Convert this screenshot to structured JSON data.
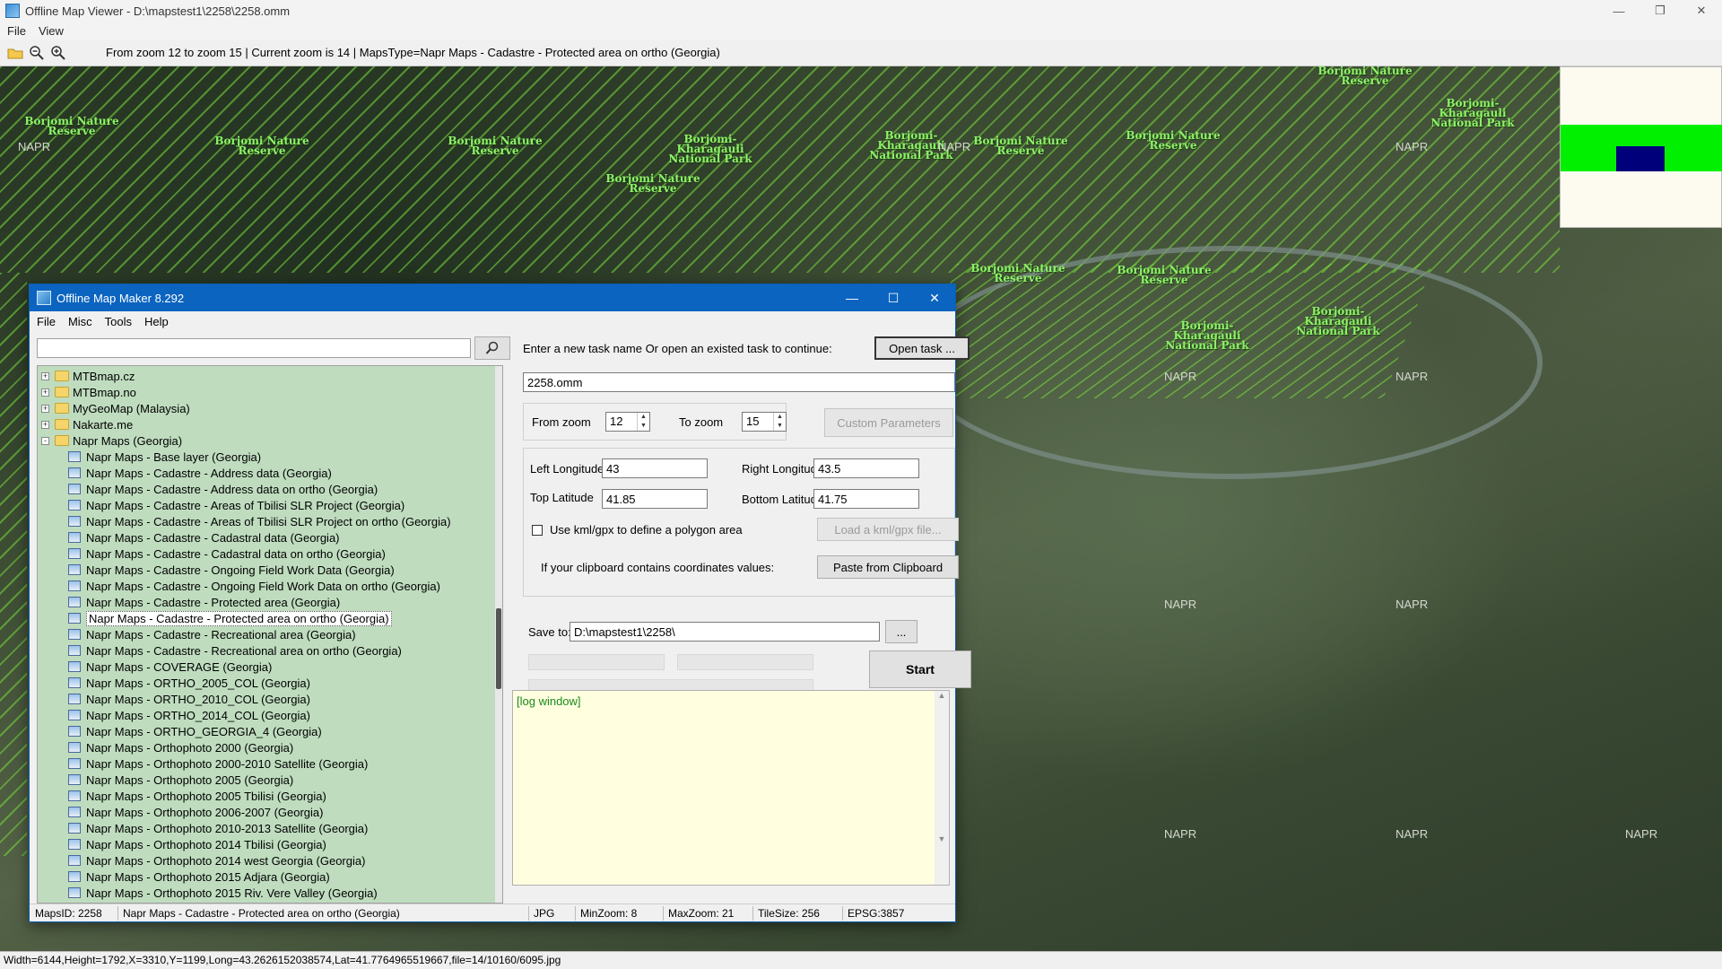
{
  "viewer": {
    "title": "Offline Map Viewer - D:\\mapstest1\\2258\\2258.omm",
    "menu": [
      "File",
      "View"
    ],
    "toolbar_info": "From zoom 12 to zoom 15   |   Current zoom is 14  |   MapsType=Napr Maps - Cadastre - Protected area on ortho (Georgia)",
    "status": "Width=6144,Height=1792,X=3310,Y=1199,Long=43.2626152038574,Lat=41.7764965519667,file=14/10160/6095.jpg",
    "map_labels": {
      "borjomi_nature_reserve": "Borjomi Nature Reserve",
      "borjomi_kharagauli": "Borjomi-Kharagauli National Park",
      "napr": "NAPR"
    }
  },
  "dialog": {
    "title": "Offline Map Maker 8.292",
    "menu": [
      "File",
      "Misc",
      "Tools",
      "Help"
    ],
    "search_value": "",
    "tree": [
      {
        "label": "MTBmap.cz",
        "type": "folder",
        "expander": "+"
      },
      {
        "label": "MTBmap.no",
        "type": "folder",
        "expander": "+"
      },
      {
        "label": "MyGeoMap (Malaysia)",
        "type": "folder",
        "expander": "+"
      },
      {
        "label": "Nakarte.me",
        "type": "folder",
        "expander": "+"
      },
      {
        "label": "Napr Maps (Georgia)",
        "type": "folder-open",
        "expander": "-"
      },
      {
        "label": "Napr Maps - Base layer (Georgia)",
        "type": "map"
      },
      {
        "label": "Napr Maps - Cadastre - Address data (Georgia)",
        "type": "map"
      },
      {
        "label": "Napr Maps - Cadastre - Address data on ortho (Georgia)",
        "type": "map"
      },
      {
        "label": "Napr Maps - Cadastre - Areas of Tbilisi SLR Project (Georgia)",
        "type": "map"
      },
      {
        "label": "Napr Maps - Cadastre - Areas of Tbilisi SLR Project on ortho (Georgia)",
        "type": "map"
      },
      {
        "label": "Napr Maps - Cadastre - Cadastral data (Georgia)",
        "type": "map"
      },
      {
        "label": "Napr Maps - Cadastre - Cadastral data on ortho (Georgia)",
        "type": "map"
      },
      {
        "label": "Napr Maps - Cadastre - Ongoing Field Work Data (Georgia)",
        "type": "map"
      },
      {
        "label": "Napr Maps - Cadastre - Ongoing Field Work Data on ortho (Georgia)",
        "type": "map"
      },
      {
        "label": "Napr Maps - Cadastre - Protected area (Georgia)",
        "type": "map"
      },
      {
        "label": "Napr Maps - Cadastre - Protected area on ortho (Georgia)",
        "type": "map",
        "selected": true
      },
      {
        "label": "Napr Maps - Cadastre - Recreational area (Georgia)",
        "type": "map"
      },
      {
        "label": "Napr Maps - Cadastre - Recreational area on ortho (Georgia)",
        "type": "map"
      },
      {
        "label": "Napr Maps - COVERAGE (Georgia)",
        "type": "map"
      },
      {
        "label": "Napr Maps - ORTHO_2005_COL (Georgia)",
        "type": "map"
      },
      {
        "label": "Napr Maps - ORTHO_2010_COL (Georgia)",
        "type": "map"
      },
      {
        "label": "Napr Maps - ORTHO_2014_COL (Georgia)",
        "type": "map"
      },
      {
        "label": "Napr Maps - ORTHO_GEORGIA_4 (Georgia)",
        "type": "map"
      },
      {
        "label": "Napr Maps - Orthophoto 2000 (Georgia)",
        "type": "map"
      },
      {
        "label": "Napr Maps - Orthophoto 2000-2010 Satellite (Georgia)",
        "type": "map"
      },
      {
        "label": "Napr Maps - Orthophoto 2005 (Georgia)",
        "type": "map"
      },
      {
        "label": "Napr Maps - Orthophoto 2005 Tbilisi (Georgia)",
        "type": "map"
      },
      {
        "label": "Napr Maps - Orthophoto 2006-2007 (Georgia)",
        "type": "map"
      },
      {
        "label": "Napr Maps - Orthophoto 2010-2013 Satellite (Georgia)",
        "type": "map"
      },
      {
        "label": "Napr Maps - Orthophoto 2014 Tbilisi (Georgia)",
        "type": "map"
      },
      {
        "label": "Napr Maps - Orthophoto 2014 west Georgia (Georgia)",
        "type": "map"
      },
      {
        "label": "Napr Maps - Orthophoto 2015 Adjara (Georgia)",
        "type": "map"
      },
      {
        "label": "Napr Maps - Orthophoto 2015 Riv. Vere Valley (Georgia)",
        "type": "map"
      }
    ],
    "task_prompt": "Enter a new task name Or open an existed task to continue:",
    "open_task_label": "Open task ...",
    "task_name": "2258.omm",
    "from_zoom_label": "From zoom",
    "from_zoom": "12",
    "to_zoom_label": "To zoom",
    "to_zoom": "15",
    "custom_params_label": "Custom Parameters",
    "left_lon_label": "Left Longitude",
    "left_lon": "43",
    "right_lon_label": "Right Longitude",
    "right_lon": "43.5",
    "top_lat_label": "Top Latitude",
    "top_lat": "41.85",
    "bottom_lat_label": "Bottom Latitude",
    "bottom_lat": "41.75",
    "kml_label": "Use kml/gpx to define a polygon area",
    "load_kml_label": "Load a kml/gpx file...",
    "clipboard_prompt": "If your clipboard contains coordinates values:",
    "paste_label": "Paste from Clipboard",
    "save_to_label": "Save to:",
    "save_to": "D:\\mapstest1\\2258\\",
    "browse_label": "...",
    "start_label": "Start",
    "log_text": "[log window]",
    "status": {
      "maps_id": "MapsID: 2258",
      "maps_name": "Napr Maps - Cadastre - Protected area on ortho (Georgia)",
      "format": "JPG",
      "min_zoom": "MinZoom: 8",
      "max_zoom": "MaxZoom: 21",
      "tile_size": "TileSize: 256",
      "epsg": "EPSG:3857"
    }
  }
}
